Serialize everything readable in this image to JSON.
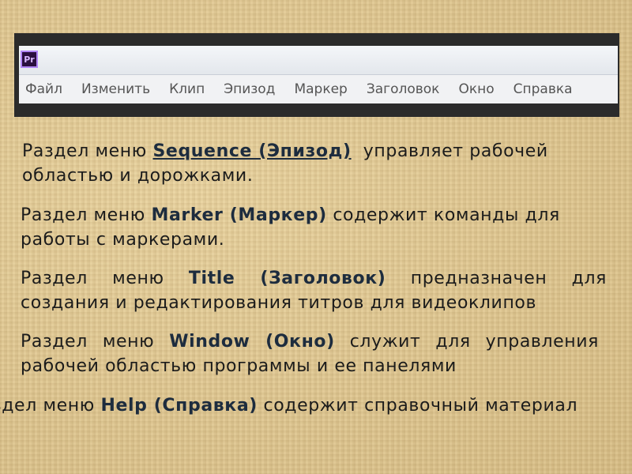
{
  "app": {
    "logo_text": "Pr",
    "menu": [
      "Файл",
      "Изменить",
      "Клип",
      "Эпизод",
      "Маркер",
      "Заголовок",
      "Окно",
      "Справка"
    ]
  },
  "paragraphs": {
    "p1": {
      "pre": "Раздел меню ",
      "term": "Sequence (Эпизод)",
      "post": "  управляет рабочей областью и дорожками."
    },
    "p2": {
      "pre": "Раздел меню ",
      "term": "Marker (Маркер)",
      "post": " содержит команды для работы с маркерами."
    },
    "p3": {
      "pre": "Раздел меню ",
      "term": "Title (Заголовок)",
      "post": " предназначен для создания и редактирования титров для видеоклипов"
    },
    "p4": {
      "pre": "Раздел меню ",
      "term": "Window (Окно)",
      "post": " служит для управления рабочей областью программы и ее панелями"
    },
    "p5": {
      "pre": "Раздел меню ",
      "term": "Help (Справка)",
      "post": " содержит справочный материал"
    }
  }
}
